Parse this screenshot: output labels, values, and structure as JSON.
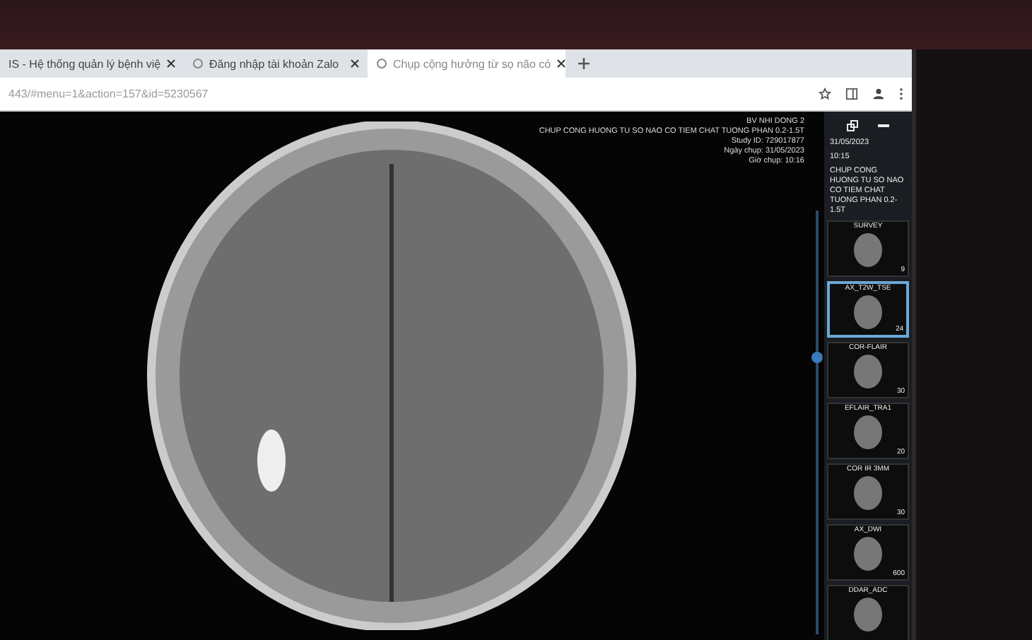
{
  "tabs": [
    {
      "title": "IS - Hệ thống quản lý bệnh việ",
      "selected": false
    },
    {
      "title": "Đăng nhập tài khoản Zalo",
      "selected": false
    },
    {
      "title": "Chụp cộng hưởng từ sọ não có",
      "selected": true
    }
  ],
  "address_bar": {
    "url": "443/#menu=1&action=157&id=5230567"
  },
  "study_overlay": [
    "BV NHI DONG 2",
    "CHUP CONG HUONG TU SO NAO CO TIEM CHAT TUONG PHAN 0.2-1.5T",
    "Study ID: 729017877",
    "Ngày chụp: 31/05/2023",
    "Giờ chụp: 10:16"
  ],
  "study_panel": {
    "date": "31/05/2023",
    "time": "10:15",
    "description": "CHUP CONG HUONG TU SO NAO CO TIEM CHAT TUONG PHAN 0.2-1.5T"
  },
  "series": [
    {
      "name": "SURVEY",
      "count": "9",
      "selected": false
    },
    {
      "name": "AX_T2W_TSE",
      "count": "24",
      "selected": true
    },
    {
      "name": "COR-FLAIR",
      "count": "30",
      "selected": false
    },
    {
      "name": "EFLAIR_TRA1",
      "count": "20",
      "selected": false
    },
    {
      "name": "COR IR 3MM",
      "count": "30",
      "selected": false
    },
    {
      "name": "AX_DWI",
      "count": "600",
      "selected": false
    },
    {
      "name": "DDAR_ADC",
      "selected": false
    }
  ]
}
